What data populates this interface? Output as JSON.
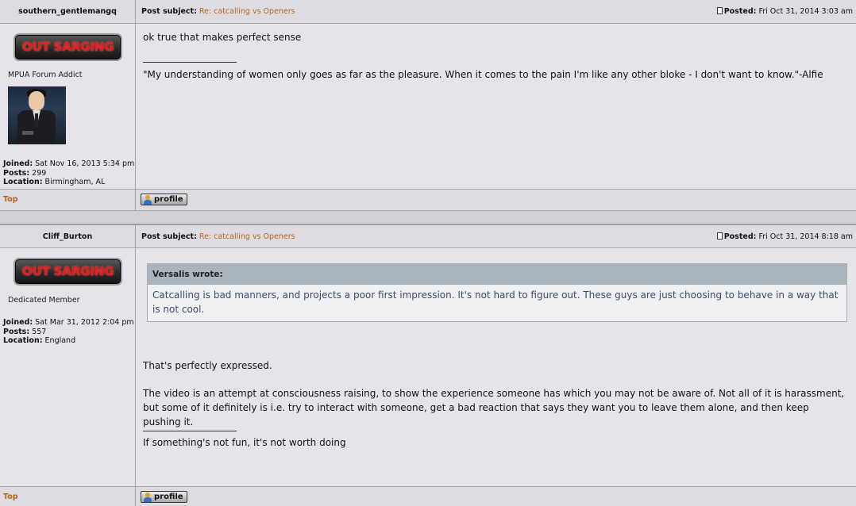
{
  "posts": [
    {
      "author": "southern_gentlemangq",
      "rank_image_text": "OUT SARGING",
      "rank_title": "MPUA Forum Addict",
      "joined_label": "Joined:",
      "joined": "Sat Nov 16, 2013 5:34 pm",
      "posts_label": "Posts:",
      "post_count": "299",
      "location_label": "Location:",
      "location": "Birmingham, AL",
      "subject_label": "Post subject:",
      "subject": "Re: catcalling vs Openers",
      "posted_label": "Posted:",
      "posted": "Fri Oct 31, 2014 3:03 am",
      "body": [
        "ok true that makes perfect sense"
      ],
      "signature": "\"My understanding of women only goes as far as the pleasure. When it comes to the pain I'm like any other bloke - I don't want to know.\"-Alfie",
      "top_link": "Top",
      "profile_button": "profile"
    },
    {
      "author": "Cliff_Burton",
      "rank_image_text": "OUT SARGING",
      "rank_title": "Dedicated Member",
      "joined_label": "Joined:",
      "joined": "Sat Mar 31, 2012 2:04 pm",
      "posts_label": "Posts:",
      "post_count": "557",
      "location_label": "Location:",
      "location": "England",
      "subject_label": "Post subject:",
      "subject": "Re: catcalling vs Openers",
      "posted_label": "Posted:",
      "posted": "Fri Oct 31, 2014 8:18 am",
      "quote_author": "Versalis wrote:",
      "quote_text": "Catcalling is bad manners, and projects a poor first impression. It's not hard to figure out. These guys are just choosing to behave in a way that is not cool.",
      "body": [
        "That's perfectly expressed.",
        "The video is an attempt at consciousness raising, to show the experience someone has which you may not be aware of. Not all of it is harassment, but some of it definitely is i.e. try to interact with someone, get a bad reaction that says they want you to leave them alone, and then keep pushing it."
      ],
      "signature": "If something's not fun, it's not worth doing",
      "top_link": "Top",
      "profile_button": "profile"
    }
  ],
  "colors": {
    "link": "#b0661e",
    "rank_text": "#e02020",
    "quote_text": "#3c4a6e"
  },
  "icons": [
    "post-doc-icon",
    "profile-person-icon"
  ]
}
